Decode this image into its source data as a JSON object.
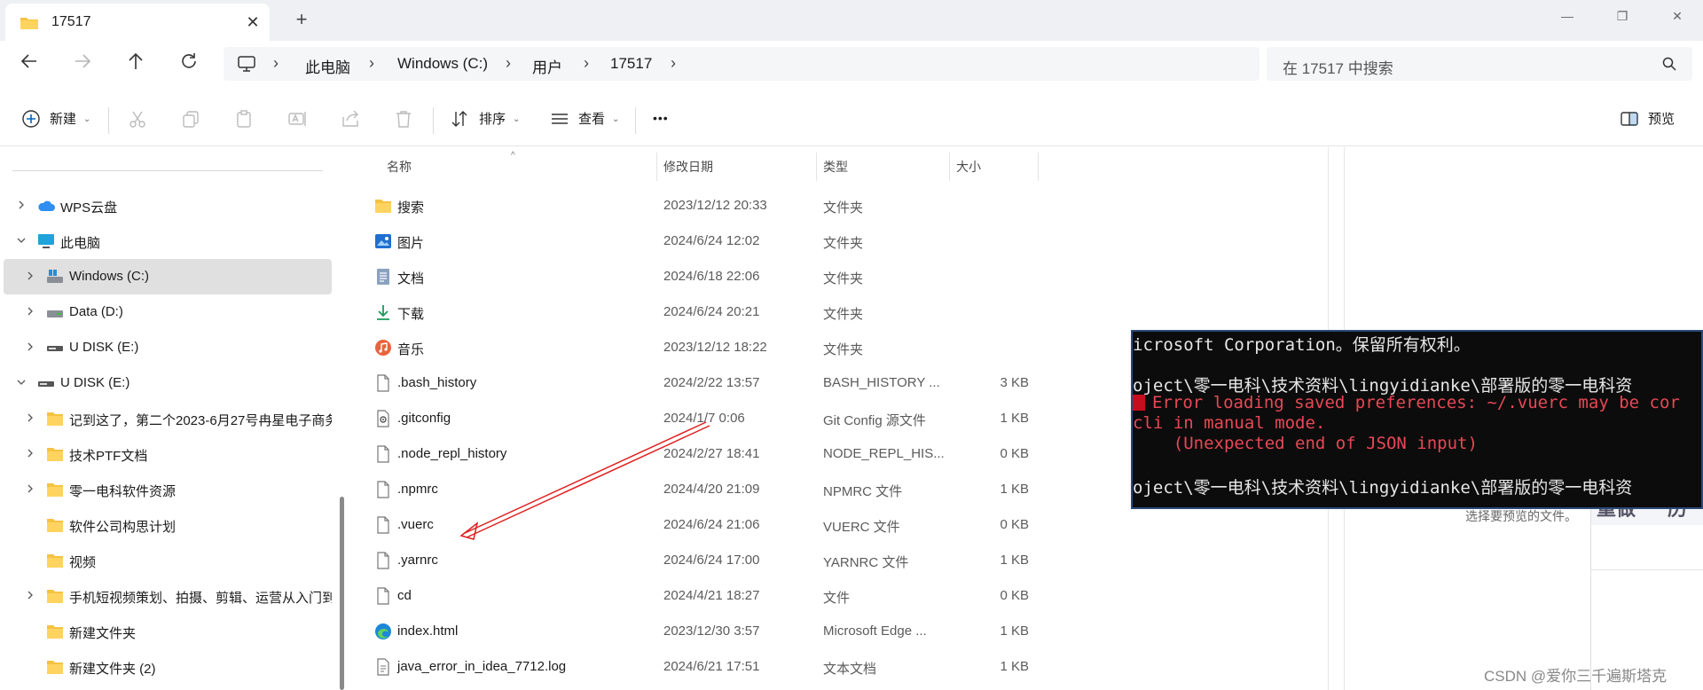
{
  "window": {
    "tab_title": "17517",
    "new_tab": "+",
    "minimize": "—",
    "restore": "❐",
    "close": "✕"
  },
  "address": {
    "crumbs": [
      "此电脑",
      "Windows (C:)",
      "用户",
      "17517"
    ],
    "search_placeholder": "在 17517 中搜索"
  },
  "commands": {
    "new": "新建",
    "sort": "排序",
    "view": "查看",
    "more": "•••",
    "preview": "预览"
  },
  "nav": {
    "items": [
      {
        "label": "WPS云盘",
        "icon": "cloud-icon"
      },
      {
        "label": "此电脑",
        "icon": "computer-icon"
      },
      {
        "label": "Windows (C:)",
        "icon": "system-drive-icon"
      },
      {
        "label": "Data (D:)",
        "icon": "drive-icon"
      },
      {
        "label": "U DISK (E:)",
        "icon": "usb-drive-icon"
      },
      {
        "label": "U DISK (E:)",
        "icon": "usb-drive-icon"
      },
      {
        "label": "记到这了，第二个2023-6月27号冉星电子商务",
        "icon": "folder-icon"
      },
      {
        "label": "技术PTF文档",
        "icon": "folder-icon"
      },
      {
        "label": "零一电科软件资源",
        "icon": "folder-icon"
      },
      {
        "label": "软件公司构思计划",
        "icon": "folder-icon"
      },
      {
        "label": "视频",
        "icon": "folder-icon"
      },
      {
        "label": "手机短视频策划、拍摄、剪辑、运营从入门到",
        "icon": "folder-icon"
      },
      {
        "label": "新建文件夹",
        "icon": "folder-icon"
      },
      {
        "label": "新建文件夹 (2)",
        "icon": "folder-icon"
      }
    ]
  },
  "columns": {
    "name": "名称",
    "modified": "修改日期",
    "type": "类型",
    "size": "大小"
  },
  "files": [
    {
      "name": "搜索",
      "date": "2023/12/12 20:33",
      "type": "文件夹",
      "size": "",
      "icon": "search-folder-icon"
    },
    {
      "name": "图片",
      "date": "2024/6/24 12:02",
      "type": "文件夹",
      "size": "",
      "icon": "pictures-icon"
    },
    {
      "name": "文档",
      "date": "2024/6/18 22:06",
      "type": "文件夹",
      "size": "",
      "icon": "documents-icon"
    },
    {
      "name": "下载",
      "date": "2024/6/24 20:21",
      "type": "文件夹",
      "size": "",
      "icon": "download-icon"
    },
    {
      "name": "音乐",
      "date": "2023/12/12 18:22",
      "type": "文件夹",
      "size": "",
      "icon": "music-icon"
    },
    {
      "name": ".bash_history",
      "date": "2024/2/22 13:57",
      "type": "BASH_HISTORY ...",
      "size": "3 KB",
      "icon": "file-icon"
    },
    {
      "name": ".gitconfig",
      "date": "2024/1/7 0:06",
      "type": "Git Config 源文件",
      "size": "1 KB",
      "icon": "config-file-icon"
    },
    {
      "name": ".node_repl_history",
      "date": "2024/2/27 18:41",
      "type": "NODE_REPL_HIS...",
      "size": "0 KB",
      "icon": "file-icon"
    },
    {
      "name": ".npmrc",
      "date": "2024/4/20 21:09",
      "type": "NPMRC 文件",
      "size": "1 KB",
      "icon": "file-icon"
    },
    {
      "name": ".vuerc",
      "date": "2024/6/24 21:06",
      "type": "VUERC 文件",
      "size": "0 KB",
      "icon": "file-icon"
    },
    {
      "name": ".yarnrc",
      "date": "2024/6/24 17:00",
      "type": "YARNRC 文件",
      "size": "1 KB",
      "icon": "file-icon"
    },
    {
      "name": "cd",
      "date": "2024/4/21 18:27",
      "type": "文件",
      "size": "0 KB",
      "icon": "file-icon"
    },
    {
      "name": "index.html",
      "date": "2023/12/30 3:57",
      "type": "Microsoft Edge ...",
      "size": "1 KB",
      "icon": "edge-icon"
    },
    {
      "name": "java_error_in_idea_7712.log",
      "date": "2024/6/21 17:51",
      "type": "文本文档",
      "size": "1 KB",
      "icon": "text-file-icon"
    }
  ],
  "preview_pane": {
    "message": "选择要预览的文件。",
    "card_title_left": "重做",
    "card_title_right": "历"
  },
  "terminal": {
    "lines": [
      "icrosoft Corporation。保留所有权利。",
      "",
      "oject\\零一电科\\技术资料\\lingyidianke\\部署版的零一电科资",
      "Error loading saved preferences: ~/.vuerc may be cor",
      "cli in manual mode.",
      "    (Unexpected end of JSON input)",
      "",
      "oject\\零一电科\\技术资料\\lingyidianke\\部署版的零一电科资"
    ]
  },
  "watermark": "CSDN @爱你三千遍斯塔克",
  "colors": {
    "folder": "#f5c242",
    "accent": "#0067c0",
    "selection": "#e0e0e0",
    "error_red": "#e74856",
    "annotation_arrow": "#e02020"
  }
}
